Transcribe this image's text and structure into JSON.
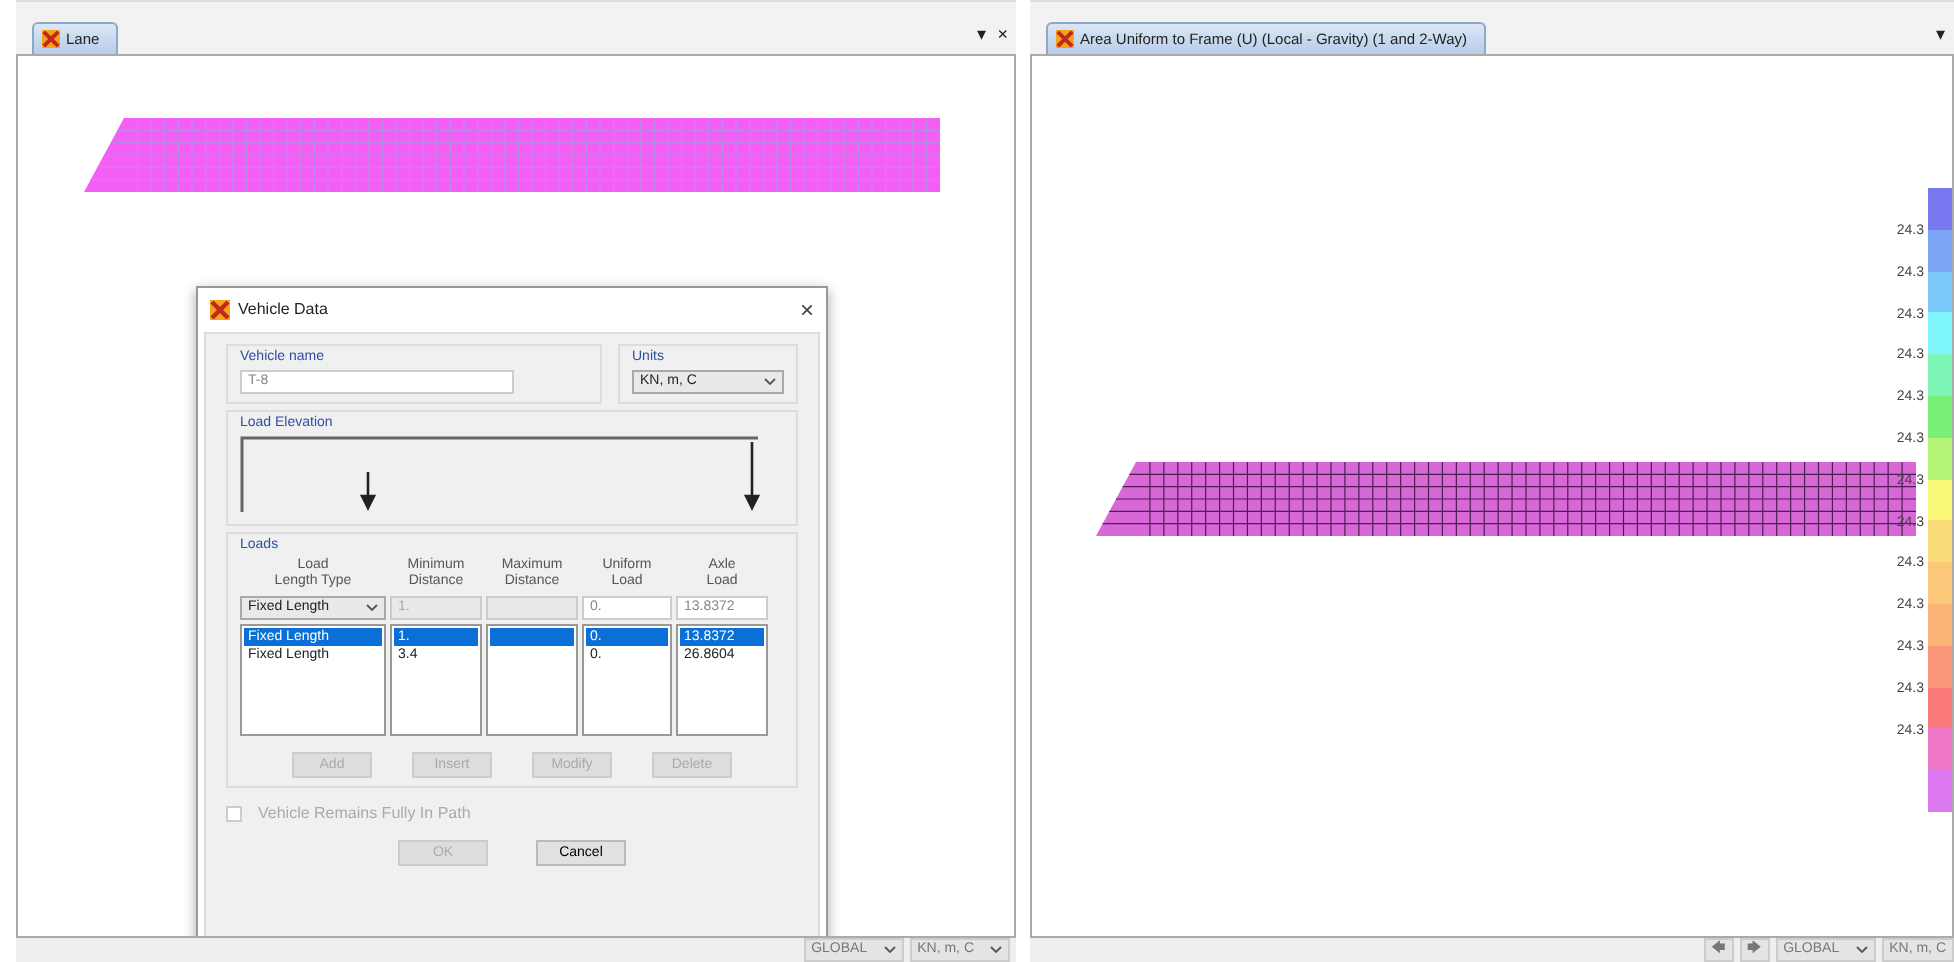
{
  "left_pane": {
    "tab": {
      "label": "Lane",
      "selected": true
    },
    "controls": [
      "▾",
      "×"
    ],
    "status_bar": {
      "coord_system": "GLOBAL",
      "units": "KN, m, C"
    }
  },
  "dialog": {
    "title": "Vehicle Data",
    "close": "×",
    "vehicle_name": {
      "label": "Vehicle name",
      "value": "T-8"
    },
    "units": {
      "label": "Units",
      "value": "KN, m, C"
    },
    "load_elevation": {
      "label": "Load Elevation"
    },
    "loads": {
      "label": "Loads",
      "columns": [
        "Load\nLength Type",
        "Minimum\nDistance",
        "Maximum\nDistance",
        "Uniform\nLoad",
        "Axle\nLoad"
      ],
      "input_row": [
        {
          "kind": "select",
          "value": "Fixed Length",
          "disabled": false
        },
        {
          "kind": "text",
          "value": "1.",
          "disabled": true
        },
        {
          "kind": "text",
          "disabled": true
        },
        {
          "kind": "text",
          "value": "0.",
          "disabled": false
        },
        {
          "kind": "text",
          "value": "13.8372",
          "disabled": false
        }
      ],
      "rows": [
        {
          "cells": [
            "Fixed Length",
            "1.",
            "",
            "0.",
            "13.8372"
          ],
          "selected": true
        },
        {
          "cells": [
            "Fixed Length",
            "3.4",
            "",
            "0.",
            "26.8604"
          ],
          "selected": false
        }
      ],
      "buttons": [
        {
          "label": "Add",
          "disabled": true
        },
        {
          "label": "Insert",
          "disabled": true
        },
        {
          "label": "Modify",
          "disabled": true
        },
        {
          "label": "Delete",
          "disabled": true
        }
      ]
    },
    "checkbox": {
      "label": "Vehicle Remains Fully In Path",
      "checked": false,
      "disabled": true
    },
    "buttons": [
      {
        "label": "OK",
        "disabled": true
      },
      {
        "label": "Cancel",
        "disabled": false
      }
    ]
  },
  "right_pane": {
    "tab": {
      "label": "Area Uniform to Frame (U) (Local - Gravity) (1 and 2-Way)",
      "selected": true
    },
    "controls": [
      "▾"
    ],
    "legend": {
      "labels": [
        "24.3",
        "24.3",
        "24.3",
        "24.3",
        "24.3",
        "24.3",
        "24.3",
        "24.3",
        "24.3",
        "24.3",
        "24.3",
        "24.3",
        "24.3"
      ],
      "swatches": [
        {
          "color": "#7878f0"
        },
        {
          "color": "#7ba6f5"
        },
        {
          "color": "#7cc8fa"
        },
        {
          "color": "#7df5fa"
        },
        {
          "color": "#7df5b4"
        },
        {
          "color": "#78f078"
        },
        {
          "color": "#b4f578"
        },
        {
          "color": "#fafa78"
        },
        {
          "color": "#fadc78"
        },
        {
          "color": "#fac878"
        },
        {
          "color": "#fab478"
        },
        {
          "color": "#fa9678"
        },
        {
          "color": "#fa7878"
        },
        {
          "color": "#f078c8"
        },
        {
          "color": "#dc78f0"
        }
      ]
    },
    "status_bar": {
      "back": "🡄",
      "forward": "🡆",
      "coord_system": "GLOBAL",
      "units": "KN, m, C"
    }
  }
}
